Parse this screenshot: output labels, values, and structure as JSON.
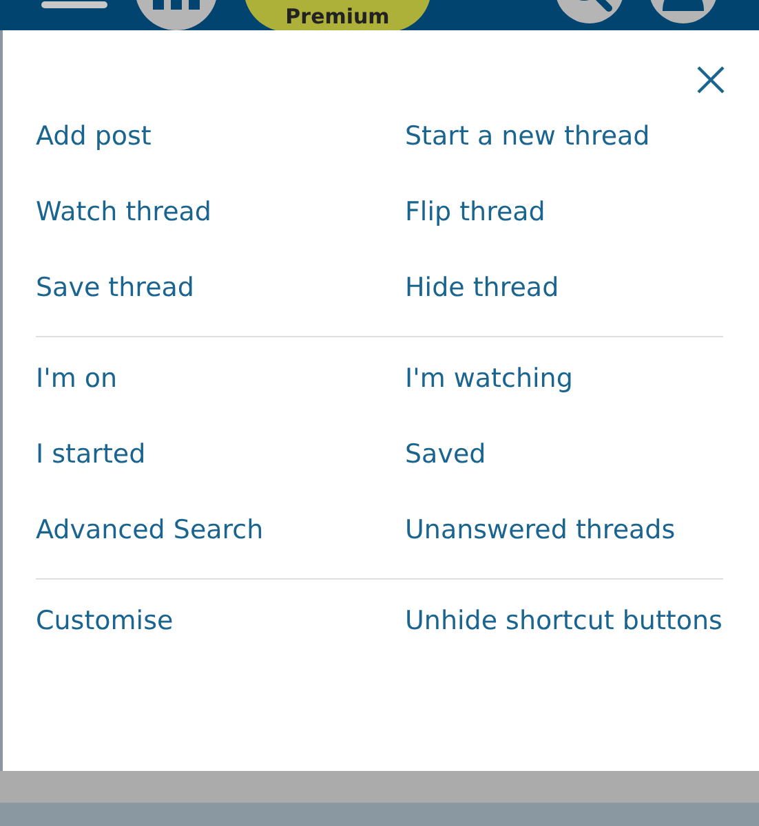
{
  "top_bar": {
    "premium_button": "Premium"
  },
  "menu": {
    "sections": [
      {
        "items": [
          {
            "label": "Add post"
          },
          {
            "label": "Start a new thread"
          },
          {
            "label": "Watch thread"
          },
          {
            "label": "Flip thread"
          },
          {
            "label": "Save thread"
          },
          {
            "label": "Hide thread"
          }
        ]
      },
      {
        "items": [
          {
            "label": "I'm on"
          },
          {
            "label": "I'm watching"
          },
          {
            "label": "I started"
          },
          {
            "label": "Saved"
          },
          {
            "label": "Advanced Search"
          },
          {
            "label": "Unanswered threads"
          }
        ]
      },
      {
        "items": [
          {
            "label": "Customise"
          },
          {
            "label": "Unhide shortcut buttons"
          }
        ]
      }
    ]
  }
}
